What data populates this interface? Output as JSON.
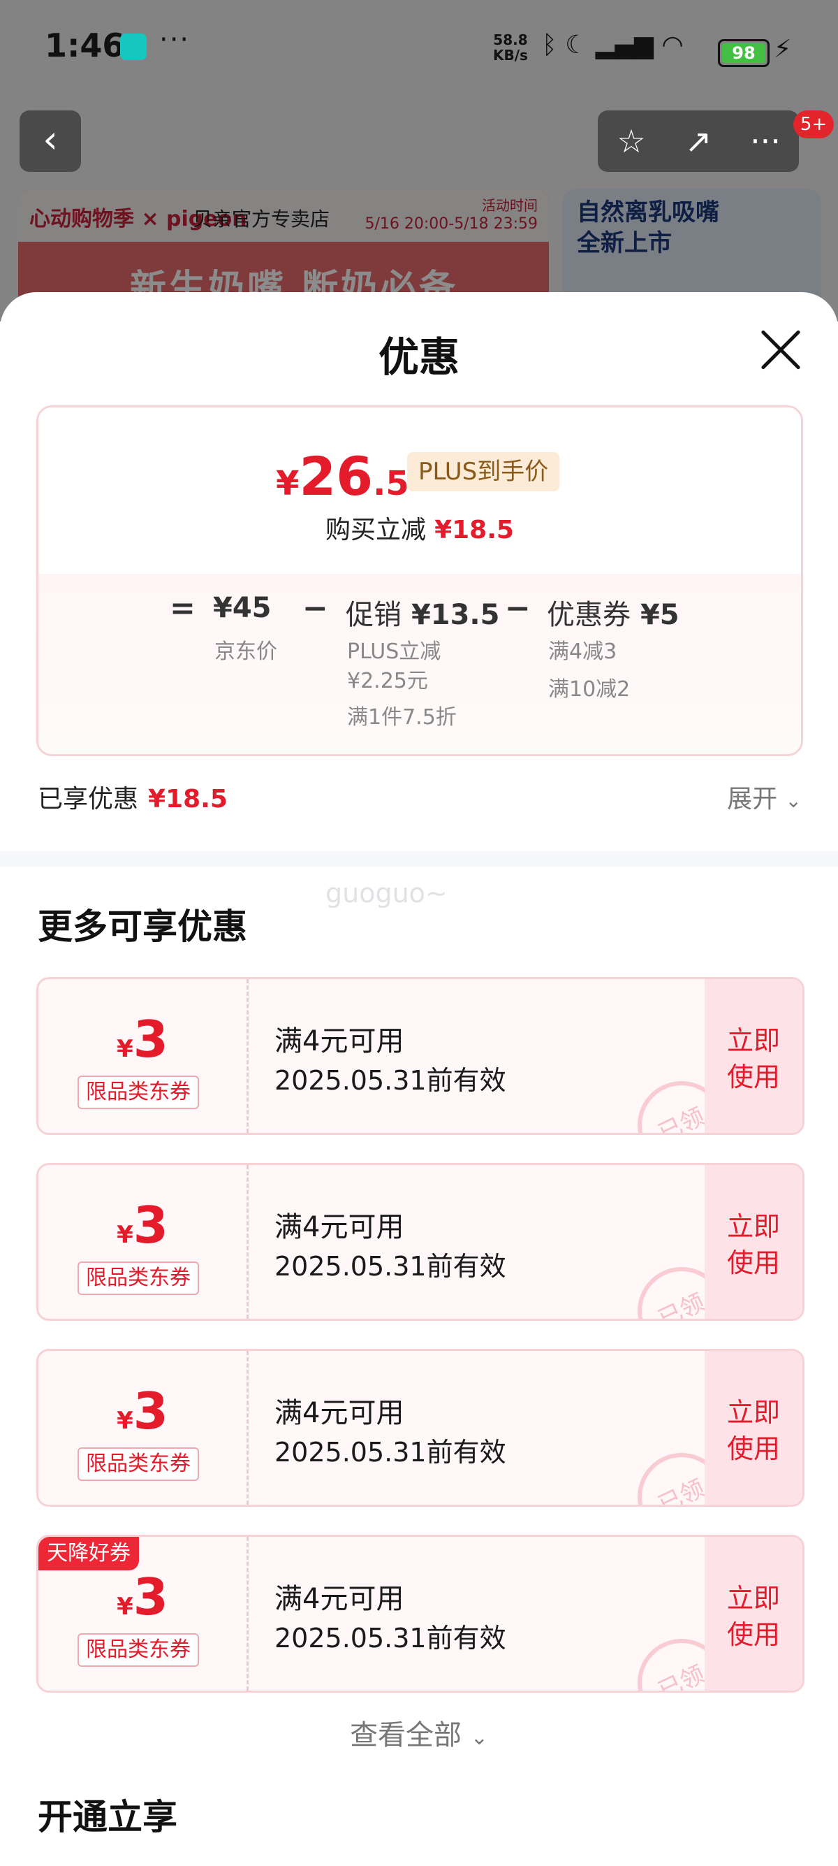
{
  "status": {
    "time": "1:46",
    "dots": "···",
    "speed_top": "58.8",
    "speed_bot": "KB/s",
    "battery": "98"
  },
  "nav": {
    "back": "‹",
    "star": "☆",
    "share": "↗",
    "more": "···",
    "badge": "5+"
  },
  "banners": {
    "b1_logo": "心动购物季 × pigeon",
    "b1_shop": "贝亲官方专卖店",
    "b1_time_title": "活动时间",
    "b1_time": "5/16 20:00-5/18 23:59",
    "b1_slogan": "新生奶嘴 断奶必备",
    "b2_title": "自然离乳吸嘴 全新上市"
  },
  "sheet": {
    "title": "优惠"
  },
  "price": {
    "currency": "¥",
    "int": "26",
    "dec": ".5",
    "plus_tag": "PLUS到手价",
    "reduce_label": "购买立减",
    "reduce_val": "¥18.5",
    "eq": "=",
    "minus": "−",
    "jd_price": "¥45",
    "jd_label": "京东价",
    "promo_label": "促销",
    "promo_val": "¥13.5",
    "promo_sub1": "PLUS立减",
    "promo_sub2": "¥2.25元",
    "promo_sub3": "满1件7.5折",
    "coupon_label": "优惠券",
    "coupon_val": "¥5",
    "coupon_sub1": "满4减3",
    "coupon_sub2": "满10减2"
  },
  "enjoyed": {
    "label": "已享优惠",
    "value": "¥18.5",
    "expand": "展开"
  },
  "watermark": "guoguo~",
  "more_title": "更多可享优惠",
  "coupons": [
    {
      "currency": "¥",
      "amount": "3",
      "type": "限品类东券",
      "condition": "满4元可用",
      "validity": "2025.05.31前有效",
      "button": "立即使用",
      "stamp": "已领",
      "tag": ""
    },
    {
      "currency": "¥",
      "amount": "3",
      "type": "限品类东券",
      "condition": "满4元可用",
      "validity": "2025.05.31前有效",
      "button": "立即使用",
      "stamp": "已领",
      "tag": ""
    },
    {
      "currency": "¥",
      "amount": "3",
      "type": "限品类东券",
      "condition": "满4元可用",
      "validity": "2025.05.31前有效",
      "button": "立即使用",
      "stamp": "已领",
      "tag": ""
    },
    {
      "currency": "¥",
      "amount": "3",
      "type": "限品类东券",
      "condition": "满4元可用",
      "validity": "2025.05.31前有效",
      "button": "立即使用",
      "stamp": "已领",
      "tag": "天降好券"
    }
  ],
  "view_all": "查看全部",
  "open_title": "开通立享",
  "colors": {
    "accent": "#e31b2b",
    "coupon_bg": "#fff7f8",
    "plus_bg": "#fcecd7"
  }
}
